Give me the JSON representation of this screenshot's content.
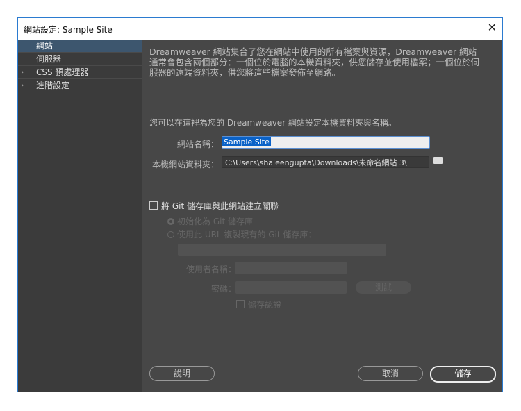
{
  "window": {
    "title": "網站設定: Sample Site",
    "close": "✕"
  },
  "sidebar": {
    "items": [
      {
        "label": "網站",
        "selected": true
      },
      {
        "label": "伺服器"
      },
      {
        "label": "CSS 預處理器",
        "chevron": "›"
      },
      {
        "label": "進階設定",
        "chevron": "›"
      }
    ]
  },
  "main": {
    "intro": "Dreamweaver 網站集合了您在網站中使用的所有檔案與資源，Dreamweaver 網站通常會包含兩個部分：一個位於電腦的本機資料夾，供您儲存並使用檔案；一個位於伺服器的遠端資料夾，供您將這些檔案發佈至網路。",
    "hint": "您可以在這裡為您的 Dreamweaver 網站設定本機資料夾與名稱。",
    "site_name_label": "網站名稱：",
    "site_name_value": "Sample Site",
    "local_folder_label": "本機網站資料夾：",
    "local_folder_value": "C:\\Users\\shaleengupta\\Downloads\\未命名網站 3\\",
    "git_checkbox": "將 Git 儲存庫與此網站建立關聯",
    "git_init": "初始化為 Git 儲存庫",
    "git_clone": "使用此 URL 複製現有的 Git 儲存庫：",
    "username_label": "使用者名稱：",
    "password_label": "密碼：",
    "test_button": "測試",
    "save_credentials": "儲存認證"
  },
  "footer": {
    "help": "說明",
    "cancel": "取消",
    "save": "儲存"
  }
}
